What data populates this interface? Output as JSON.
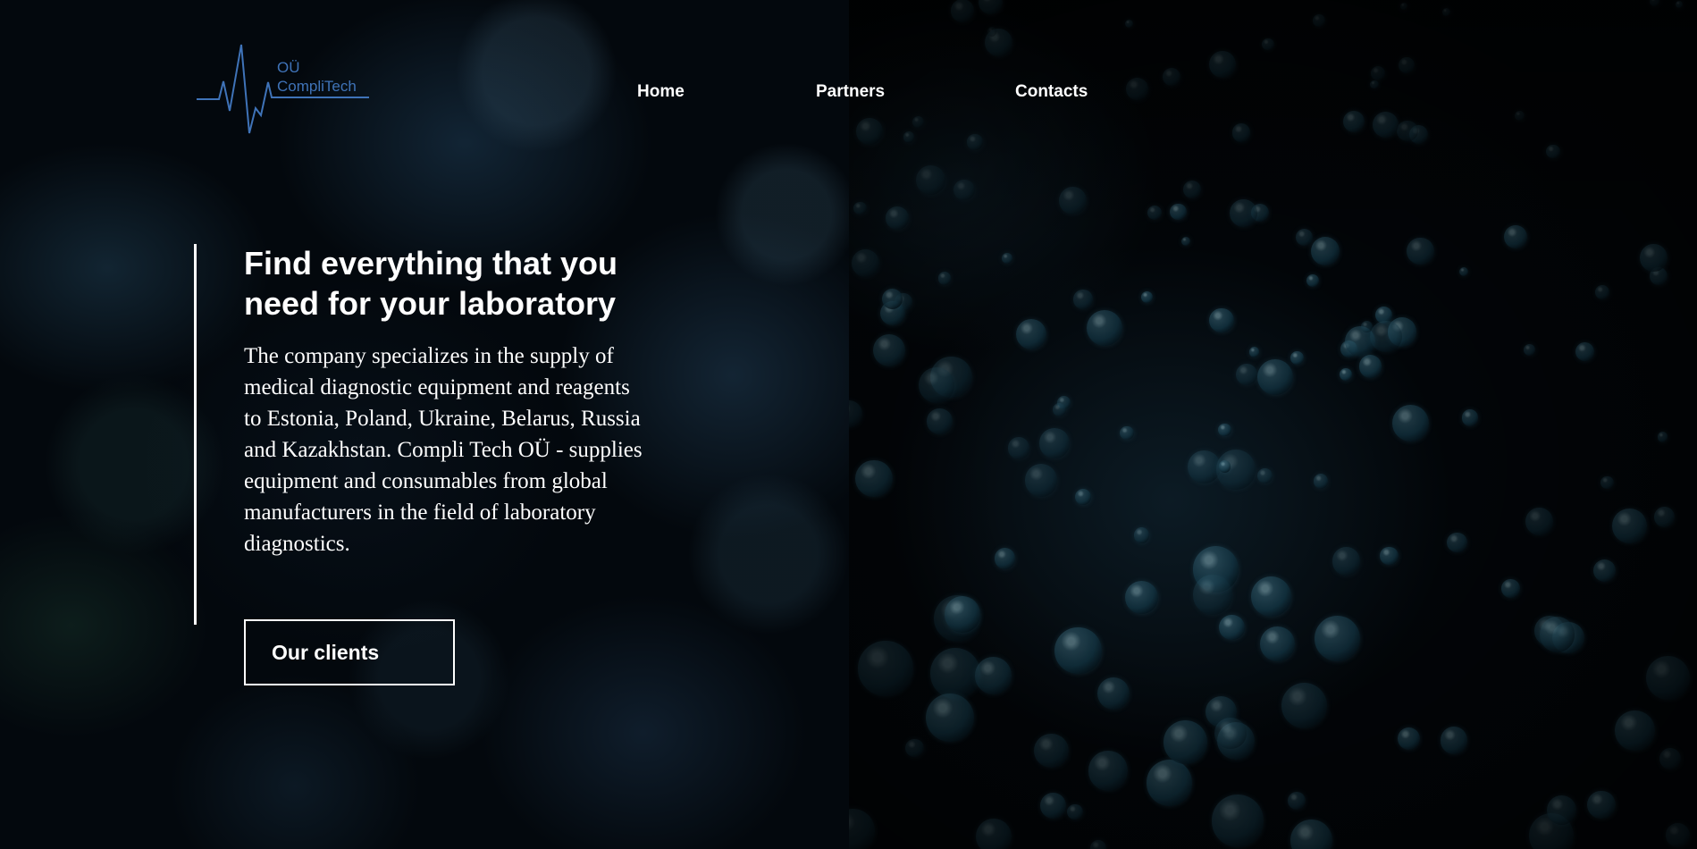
{
  "header": {
    "logo": {
      "line1": "OÜ",
      "line2": "CompliTech",
      "icon": "heartbeat-icon",
      "color": "#3f73b8"
    },
    "nav": {
      "home": "Home",
      "partners": "Partners",
      "contacts": "Contacts"
    }
  },
  "hero": {
    "title": "Find everything that you need for your laboratory",
    "description": "The company specializes in the supply of medical diagnostic equipment and reagents to Estonia, Poland, Ukraine, Belarus, Russia and Kazakhstan. Compli Tech OÜ - supplies equipment and consumables from global manufacturers in the field of laboratory diagnostics.",
    "button_label": "Our clients"
  },
  "colors": {
    "background": "#02060b",
    "text": "#ffffff",
    "accent": "#3f73b8"
  }
}
